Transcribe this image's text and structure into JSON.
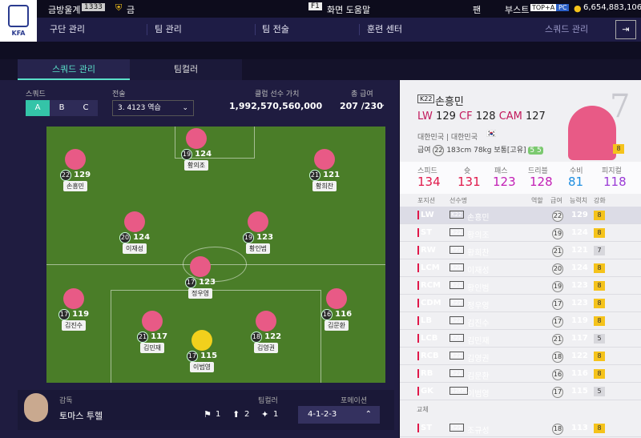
{
  "top": {
    "team_label": "금방울계",
    "rank": "1333",
    "tier": "금",
    "help_key": "F1",
    "help": "화면 도움말",
    "fan": "팬",
    "boost": "부스트",
    "boost_badge": "TOP+A",
    "pc": "PC",
    "bp": "6,654,883,106",
    "logo_text": "KFA"
  },
  "nav": {
    "items": [
      "구단 관리",
      "팀 관리",
      "팀 전술",
      "훈련 센터"
    ],
    "current": "스쿼드 관리"
  },
  "tabs": [
    "스쿼드 관리",
    "팀컬러"
  ],
  "squad": {
    "label": "스쿼드",
    "options": [
      "A",
      "B",
      "C"
    ],
    "tactic_label": "전술",
    "tactic": "3. 4123 역습",
    "value_label": "클럽 선수 가치",
    "value": "1,992,570,560,000",
    "salary_label": "총 급여",
    "salary": "207 /230"
  },
  "field_players": [
    {
      "name": "황의조",
      "ovr": "124",
      "grade": "19"
    },
    {
      "name": "손흥민",
      "ovr": "129",
      "grade": "22"
    },
    {
      "name": "황희찬",
      "ovr": "121",
      "grade": "21"
    },
    {
      "name": "이재성",
      "ovr": "124",
      "grade": "20"
    },
    {
      "name": "황인범",
      "ovr": "123",
      "grade": "19"
    },
    {
      "name": "정우영",
      "ovr": "123",
      "grade": "17"
    },
    {
      "name": "김진수",
      "ovr": "119",
      "grade": "17"
    },
    {
      "name": "김문환",
      "ovr": "116",
      "grade": "16"
    },
    {
      "name": "김민재",
      "ovr": "117",
      "grade": "21"
    },
    {
      "name": "김영권",
      "ovr": "122",
      "grade": "18"
    },
    {
      "name": "이범영",
      "ovr": "115",
      "grade": "17"
    }
  ],
  "manager": {
    "label": "감독",
    "name": "토마스 투헬"
  },
  "teamcolor": {
    "label": "팀컬러",
    "a": "1",
    "b": "2",
    "c": "1"
  },
  "formation": {
    "label": "포메이션",
    "value": "4-1-2-3"
  },
  "selected": {
    "season": "K22",
    "name": "손흥민",
    "big_number": "7",
    "pos1": "LW",
    "v1": "129",
    "pos2": "CF",
    "v2": "128",
    "pos3": "CAM",
    "v3": "127",
    "nation": "대한민국 | 대한민국",
    "salary_label": "급여",
    "salary": "22",
    "height": "183cm",
    "weight": "78kg",
    "body": "보통[고유]",
    "feet": "5 5",
    "upgrade": "8",
    "stats": [
      {
        "label": "스피드",
        "value": "134",
        "color": "#e0184a"
      },
      {
        "label": "슛",
        "value": "131",
        "color": "#e0184a"
      },
      {
        "label": "패스",
        "value": "123",
        "color": "#c21fb5"
      },
      {
        "label": "드리블",
        "value": "128",
        "color": "#c21fb5"
      },
      {
        "label": "수비",
        "value": "81",
        "color": "#1f8ee0"
      },
      {
        "label": "피지컬",
        "value": "118",
        "color": "#9a3ad6"
      }
    ]
  },
  "table": {
    "headers": [
      "포지션",
      "선수명",
      "역할",
      "급여",
      "능력치",
      "강화"
    ],
    "rows": [
      {
        "pos": "LW",
        "season": "K22",
        "name": "손흥민",
        "sal": "22",
        "ovr": "129",
        "enh": "8"
      },
      {
        "pos": "ST",
        "season": "K22",
        "name": "황의조",
        "sal": "19",
        "ovr": "124",
        "enh": "8"
      },
      {
        "pos": "RW",
        "season": "K22",
        "name": "황희찬",
        "sal": "21",
        "ovr": "121",
        "enh": "7"
      },
      {
        "pos": "LCM",
        "season": "K22",
        "name": "이재성",
        "sal": "20",
        "ovr": "124",
        "enh": "8"
      },
      {
        "pos": "RCM",
        "season": "K22",
        "name": "황인범",
        "sal": "19",
        "ovr": "123",
        "enh": "8"
      },
      {
        "pos": "CDM",
        "season": "K22",
        "name": "정우영",
        "sal": "17",
        "ovr": "123",
        "enh": "8"
      },
      {
        "pos": "LB",
        "season": "K22",
        "name": "김진수",
        "sal": "17",
        "ovr": "119",
        "enh": "8"
      },
      {
        "pos": "LCB",
        "season": "K22",
        "name": "김민재",
        "sal": "21",
        "ovr": "117",
        "enh": "5"
      },
      {
        "pos": "RCB",
        "season": "K22",
        "name": "김영권",
        "sal": "18",
        "ovr": "122",
        "enh": "8"
      },
      {
        "pos": "RB",
        "season": "K22",
        "name": "김문환",
        "sal": "16",
        "ovr": "116",
        "enh": "8"
      },
      {
        "pos": "GK",
        "season": "12KH",
        "name": "이범영",
        "sal": "17",
        "ovr": "115",
        "enh": "5"
      }
    ],
    "sub_label": "교체",
    "subs": [
      {
        "pos": "ST",
        "season": "K22",
        "name": "조규성",
        "sal": "18",
        "ovr": "113",
        "enh": "8"
      }
    ]
  }
}
